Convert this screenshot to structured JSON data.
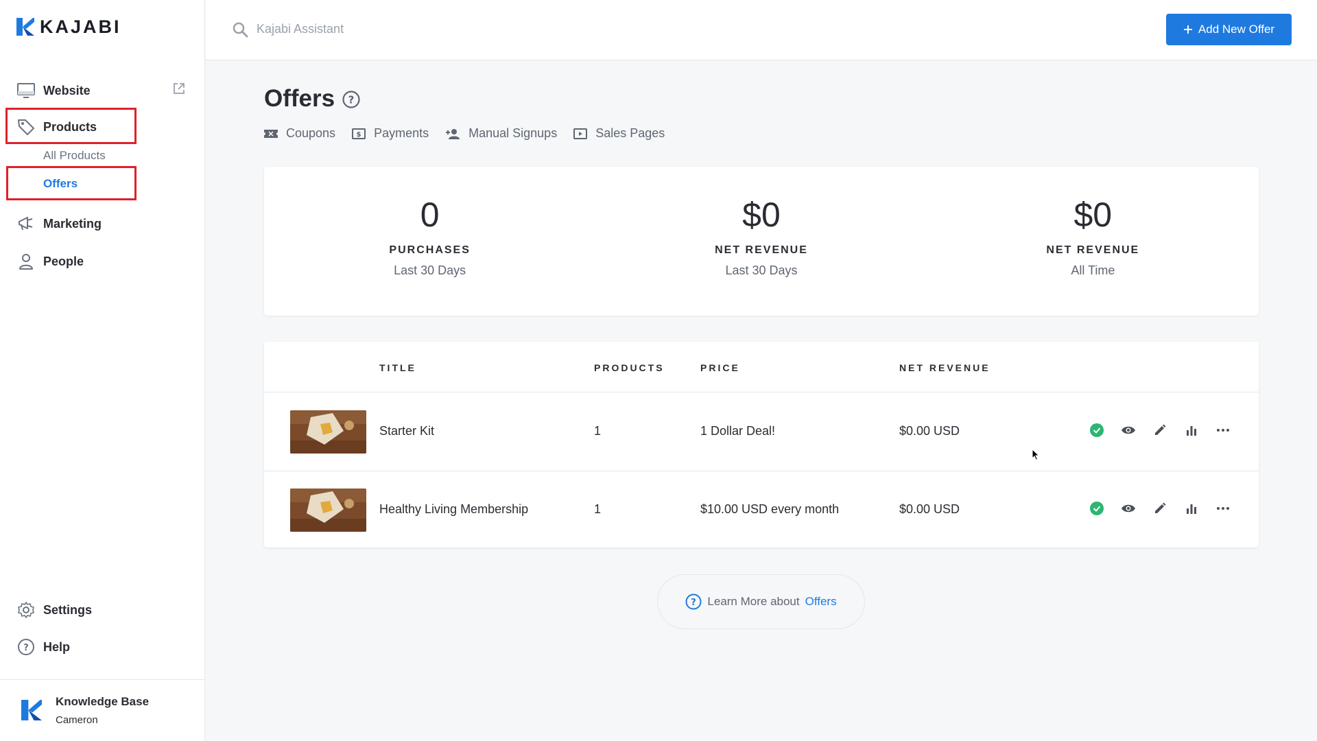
{
  "app": {
    "logo_text": "KAJABI"
  },
  "sidebar": {
    "website": "Website",
    "products": "Products",
    "all_products": "All Products",
    "offers": "Offers",
    "marketing": "Marketing",
    "people": "People",
    "settings": "Settings",
    "help": "Help",
    "footer": {
      "title": "Knowledge Base",
      "subtitle": "Cameron"
    }
  },
  "topbar": {
    "search_placeholder": "Kajabi Assistant",
    "add_button": "Add New Offer"
  },
  "page": {
    "title": "Offers",
    "subnav": [
      "Coupons",
      "Payments",
      "Manual Signups",
      "Sales Pages"
    ]
  },
  "stats": [
    {
      "value": "0",
      "label": "PURCHASES",
      "period": "Last 30 Days"
    },
    {
      "value": "$0",
      "label": "NET REVENUE",
      "period": "Last 30 Days"
    },
    {
      "value": "$0",
      "label": "NET REVENUE",
      "period": "All Time"
    }
  ],
  "table": {
    "headers": {
      "title": "TITLE",
      "products": "PRODUCTS",
      "price": "PRICE",
      "net_revenue": "NET REVENUE"
    },
    "rows": [
      {
        "title": "Starter Kit",
        "products": "1",
        "price": "1 Dollar Deal!",
        "net_revenue": "$0.00 USD"
      },
      {
        "title": "Healthy Living Membership",
        "products": "1",
        "price": "$10.00 USD every month",
        "net_revenue": "$0.00 USD"
      }
    ]
  },
  "learn_more": {
    "prefix": "Learn More about",
    "link": "Offers"
  },
  "colors": {
    "accent": "#1f7ae0",
    "highlight": "#e0202a",
    "status_green": "#2bb673"
  }
}
